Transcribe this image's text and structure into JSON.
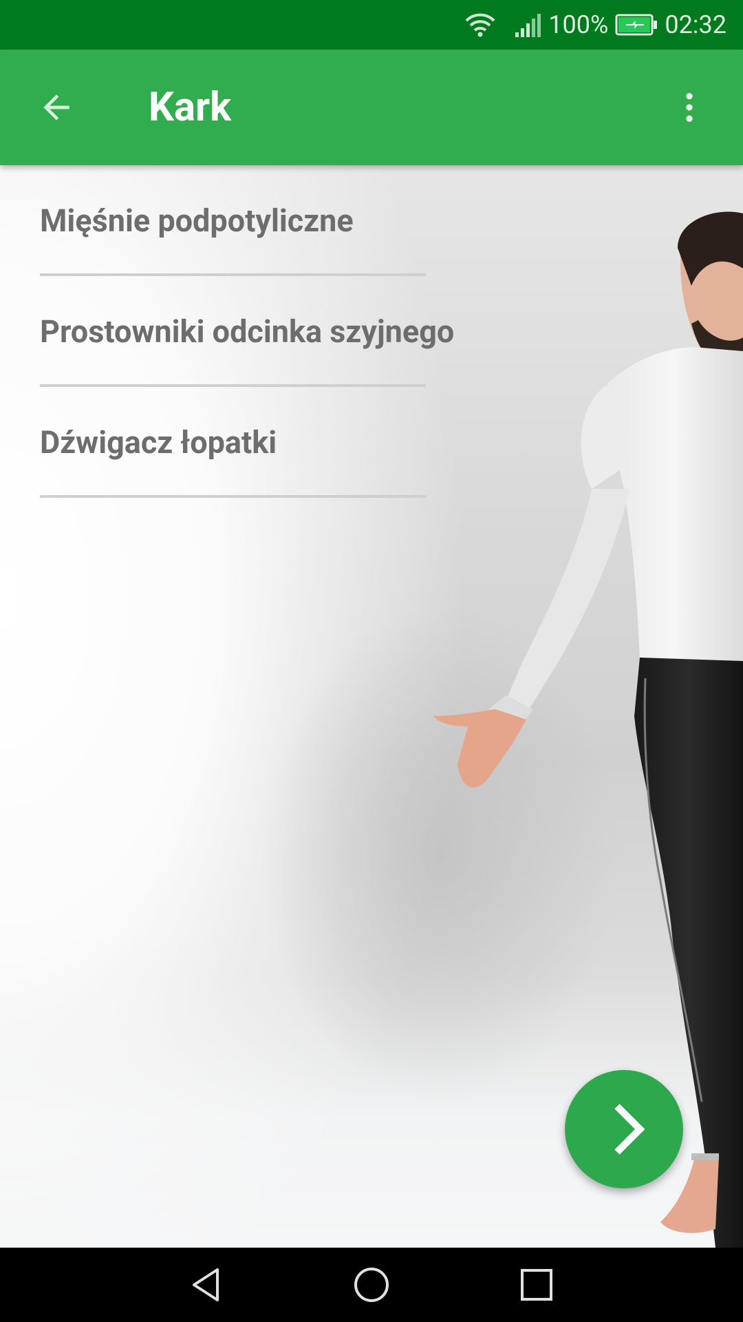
{
  "status_bar": {
    "battery_text": "100%",
    "time": "02:32",
    "icons": [
      "wifi-icon",
      "signal-icon",
      "battery-charging-icon"
    ]
  },
  "app_bar": {
    "title": "Kark",
    "back_icon": "arrow-back-icon",
    "menu_icon": "more-vert-icon"
  },
  "list": {
    "items": [
      {
        "label": "Mięśnie podpotyliczne"
      },
      {
        "label": "Prostowniki odcinka szyjnego"
      },
      {
        "label": "Dźwigacz łopatki"
      }
    ]
  },
  "fab": {
    "icon": "chevron-right-icon"
  },
  "nav_bar": {
    "icons": [
      "nav-back-icon",
      "nav-home-icon",
      "nav-recents-icon"
    ]
  },
  "colors": {
    "status_bar": "#017a1f",
    "app_bar": "#31ad4f",
    "fab": "#2ea84c",
    "list_text": "#6d6d6d",
    "divider": "#cfcfcf"
  }
}
